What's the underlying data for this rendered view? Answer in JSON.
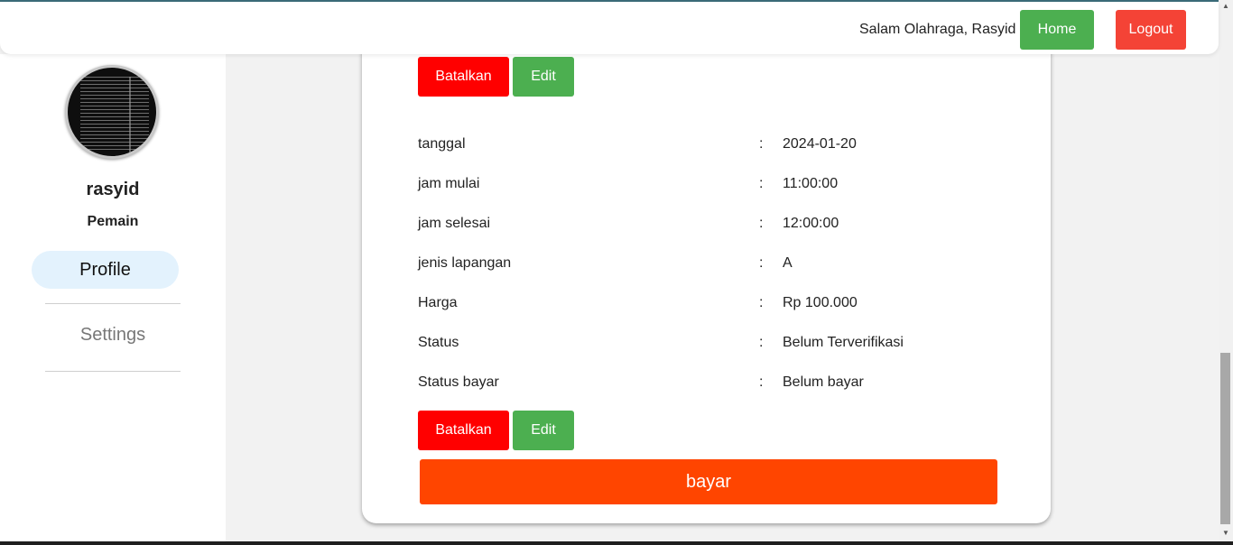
{
  "header": {
    "greeting": "Salam Olahraga, Rasyid",
    "home_label": "Home",
    "logout_label": "Logout"
  },
  "sidebar": {
    "username": "rasyid",
    "role": "Pemain",
    "items": [
      {
        "label": "Profile",
        "active": true
      },
      {
        "label": "Settings",
        "active": false
      }
    ]
  },
  "booking": {
    "cancel_label": "Batalkan",
    "edit_label": "Edit",
    "pay_label": "bayar",
    "details": [
      {
        "label": "tanggal",
        "value": "2024-01-20"
      },
      {
        "label": "jam mulai",
        "value": "11:00:00"
      },
      {
        "label": "jam selesai",
        "value": "12:00:00"
      },
      {
        "label": "jenis lapangan",
        "value": "A"
      },
      {
        "label": "Harga",
        "value": "Rp 100.000"
      },
      {
        "label": "Status",
        "value": "Belum Terverifikasi"
      },
      {
        "label": "Status bayar",
        "value": "Belum bayar"
      }
    ],
    "separator": ":"
  },
  "colors": {
    "home": "#4caf50",
    "logout": "#f44336",
    "cancel": "#ff0000",
    "edit": "#4caf50",
    "pay": "#ff4500",
    "active_nav": "#e3f2fd"
  }
}
